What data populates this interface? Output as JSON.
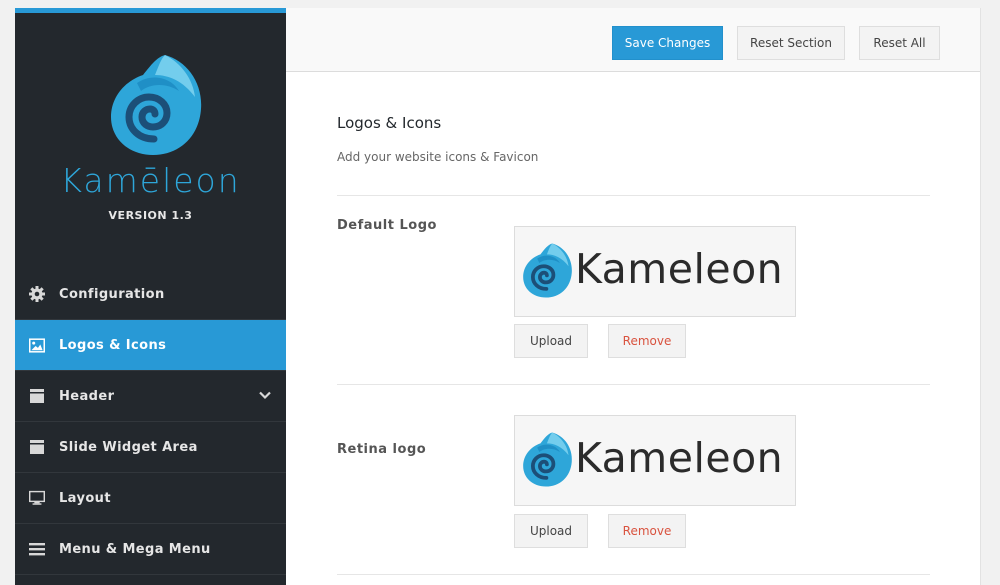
{
  "brand": {
    "name": "Kamēleon",
    "version": "VERSION 1.3",
    "accent_color": "#2899d6"
  },
  "sidebar": {
    "items": [
      {
        "label": "Configuration",
        "icon": "gear-icon",
        "active": false
      },
      {
        "label": "Logos & Icons",
        "icon": "image-icon",
        "active": true
      },
      {
        "label": "Header",
        "icon": "panel-icon",
        "active": false,
        "has_submenu": true
      },
      {
        "label": "Slide Widget Area",
        "icon": "panel-icon",
        "active": false
      },
      {
        "label": "Layout",
        "icon": "monitor-icon",
        "active": false
      },
      {
        "label": "Menu & Mega Menu",
        "icon": "hamburger-icon",
        "active": false
      }
    ]
  },
  "toolbar": {
    "save_label": "Save Changes",
    "reset_section_label": "Reset Section",
    "reset_all_label": "Reset All"
  },
  "section": {
    "title": "Logos & Icons",
    "description": "Add your website icons & Favicon"
  },
  "fields": [
    {
      "label": "Default Logo",
      "preview_text": "Kameleon",
      "upload_label": "Upload",
      "remove_label": "Remove"
    },
    {
      "label": "Retina logo",
      "preview_text": "Kameleon",
      "upload_label": "Upload",
      "remove_label": "Remove"
    }
  ]
}
